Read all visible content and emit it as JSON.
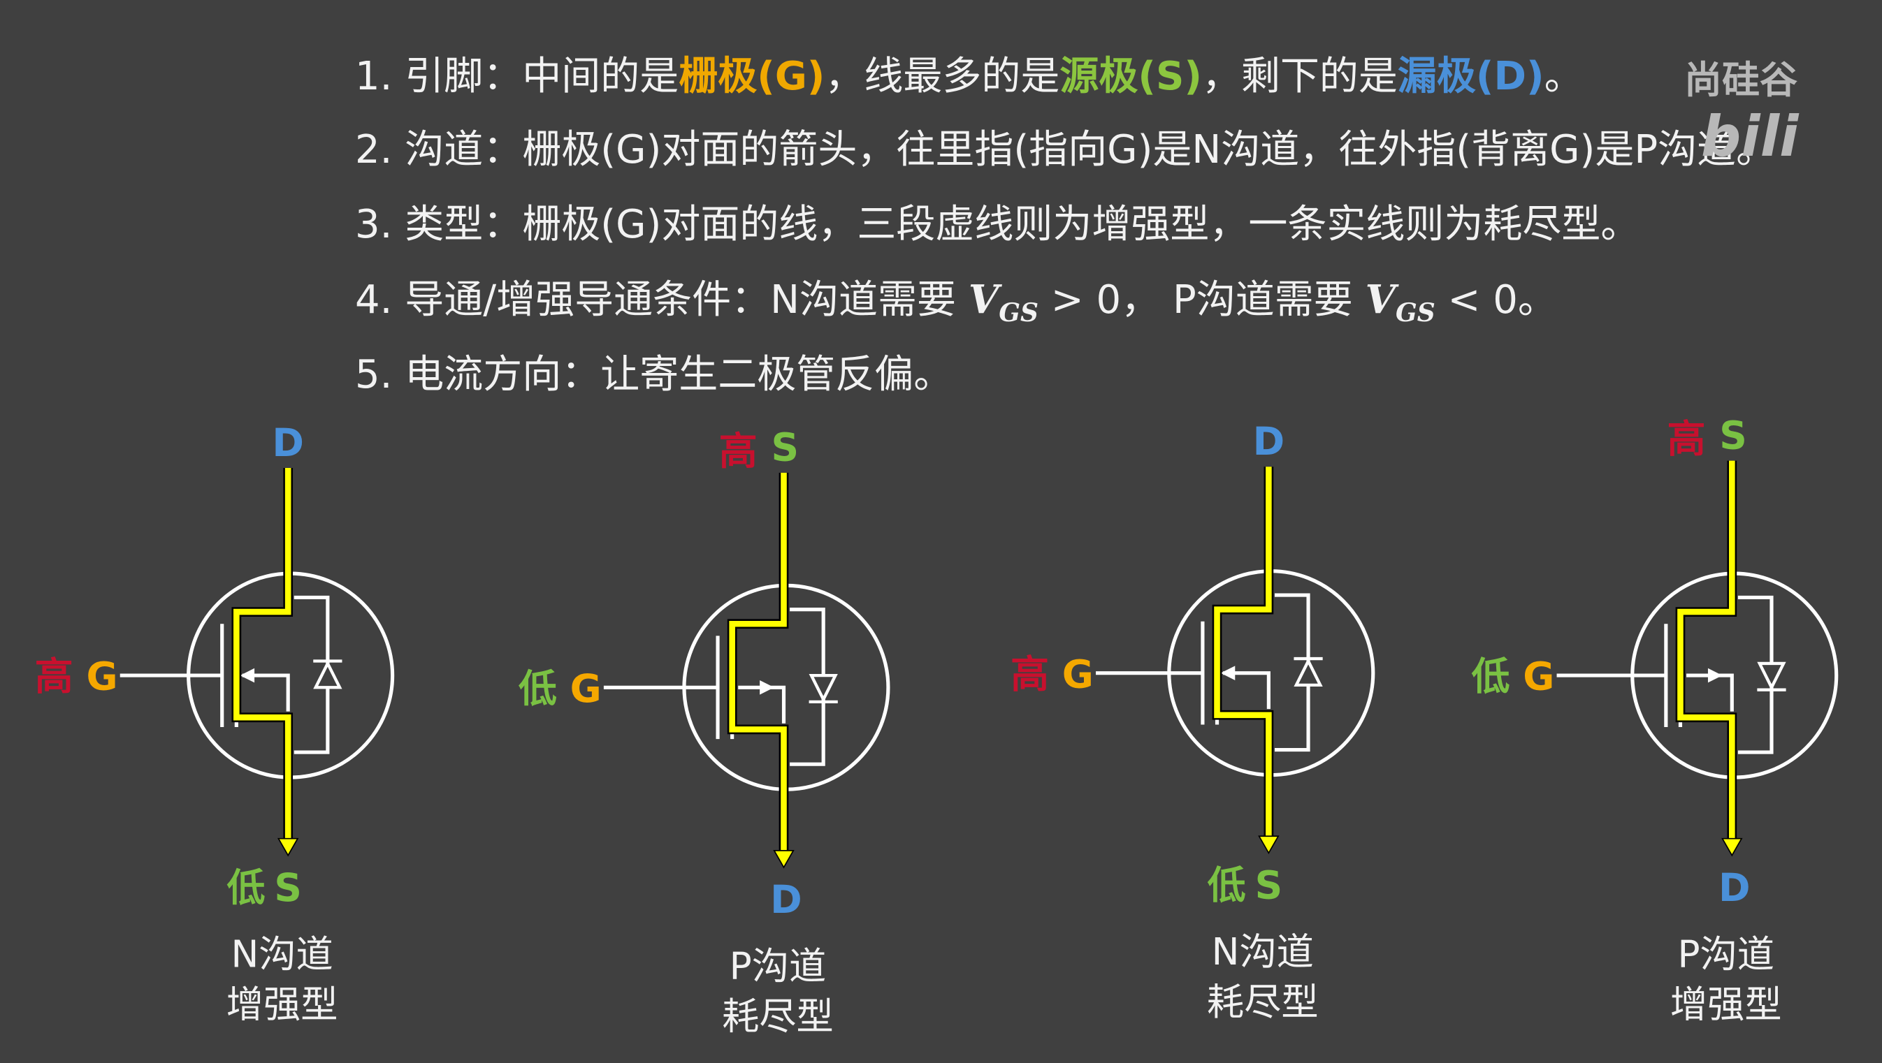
{
  "rules": {
    "l1": {
      "a": "1. 引脚：中间的是",
      "g": "栅极(G)",
      "b": "，线最多的是",
      "s": "源极(S)",
      "c": "，剩下的是",
      "d": "漏极(D)",
      "e": "。"
    },
    "l2": "2. 沟道：栅极(G)对面的箭头，往里指(指向G)是N沟道，往外指(背离G)是P沟道。",
    "l3": "3. 类型：栅极(G)对面的线，三段虚线则为增强型，一条实线则为耗尽型。",
    "l4": {
      "a": "4. 导通/增强导通条件：N沟道需要 ",
      "v": "V",
      "sub": "GS",
      "b": " > 0，  P沟道需要 ",
      "c": " < 0。"
    },
    "l5": "5. 电流方向：让寄生二极管反偏。"
  },
  "logo": {
    "brand": "尚硅谷",
    "site": "bili"
  },
  "symbols": [
    {
      "channel": "N",
      "mode": "enhancement",
      "top": {
        "level": "",
        "pin": "D"
      },
      "gate": {
        "level": "高",
        "pin": "G"
      },
      "bottom": {
        "level": "低",
        "pin": "S"
      },
      "caption": [
        "N沟道",
        "增强型"
      ]
    },
    {
      "channel": "P",
      "mode": "depletion",
      "top": {
        "level": "高",
        "pin": "S"
      },
      "gate": {
        "level": "低",
        "pin": "G"
      },
      "bottom": {
        "level": "",
        "pin": "D"
      },
      "caption": [
        "P沟道",
        "耗尽型"
      ]
    },
    {
      "channel": "N",
      "mode": "depletion",
      "top": {
        "level": "",
        "pin": "D"
      },
      "gate": {
        "level": "高",
        "pin": "G"
      },
      "bottom": {
        "level": "低",
        "pin": "S"
      },
      "caption": [
        "N沟道",
        "耗尽型"
      ]
    },
    {
      "channel": "P",
      "mode": "enhancement",
      "top": {
        "level": "高",
        "pin": "S"
      },
      "gate": {
        "level": "低",
        "pin": "G"
      },
      "bottom": {
        "level": "",
        "pin": "D"
      },
      "caption": [
        "P沟道",
        "增强型"
      ]
    }
  ],
  "colors": {
    "D": "#4a90d9",
    "S": "#7ac143",
    "G": "#f5a800",
    "高": "#c8102e",
    "低": "#7ac143",
    "current": "#ffff00"
  }
}
